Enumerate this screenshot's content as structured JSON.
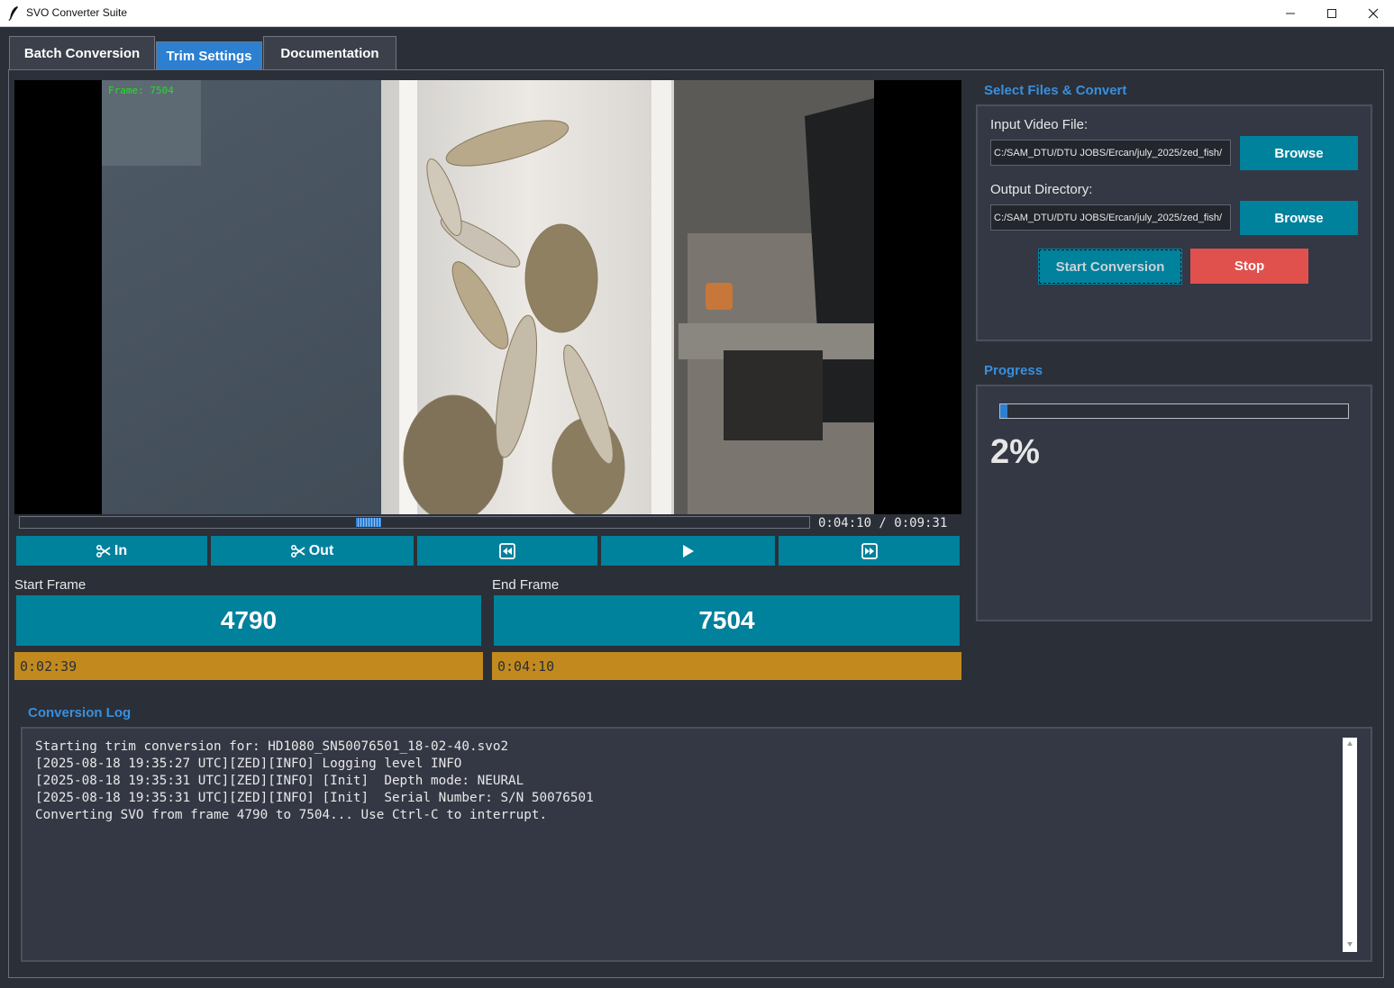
{
  "window": {
    "title": "SVO Converter Suite"
  },
  "tabs": [
    {
      "label": "Batch Conversion",
      "active": false
    },
    {
      "label": "Trim Settings",
      "active": true
    },
    {
      "label": "Documentation",
      "active": false
    }
  ],
  "player": {
    "frame_overlay": "Frame: 7504",
    "timecode": "0:04:10 / 0:09:31",
    "scrub_position_fraction": 0.44
  },
  "controls": {
    "mark_in_label": "In",
    "mark_out_label": "Out"
  },
  "trim": {
    "start_label": "Start Frame",
    "start_frame": "4790",
    "start_time": "0:02:39",
    "end_label": "End Frame",
    "end_frame": "7504",
    "end_time": "0:04:10"
  },
  "files": {
    "section_title": "Select Files & Convert",
    "input_label": "Input Video File:",
    "input_value": "C:/SAM_DTU/DTU JOBS/Ercan/july_2025/zed_fish/",
    "output_label": "Output Directory:",
    "output_value": "C:/SAM_DTU/DTU JOBS/Ercan/july_2025/zed_fish/",
    "browse_label": "Browse",
    "start_label": "Start Conversion",
    "stop_label": "Stop"
  },
  "progress": {
    "section_title": "Progress",
    "text": "2%",
    "percent": 2
  },
  "log": {
    "section_title": "Conversion Log",
    "lines": [
      "Starting trim conversion for: HD1080_SN50076501_18-02-40.svo2",
      "[2025-08-18 19:35:27 UTC][ZED][INFO] Logging level INFO",
      "[2025-08-18 19:35:31 UTC][ZED][INFO] [Init]  Depth mode: NEURAL",
      "[2025-08-18 19:35:31 UTC][ZED][INFO] [Init]  Serial Number: S/N 50076501",
      "Converting SVO from frame 4790 to 7504... Use Ctrl-C to interrupt."
    ]
  },
  "colors": {
    "background": "#2b2f38",
    "accent_teal": "#00819c",
    "active_tab_blue": "#2d7fd0",
    "time_amber": "#c28a1e",
    "stop_red": "#e0514e",
    "section_title_blue": "#3a8fdc"
  }
}
